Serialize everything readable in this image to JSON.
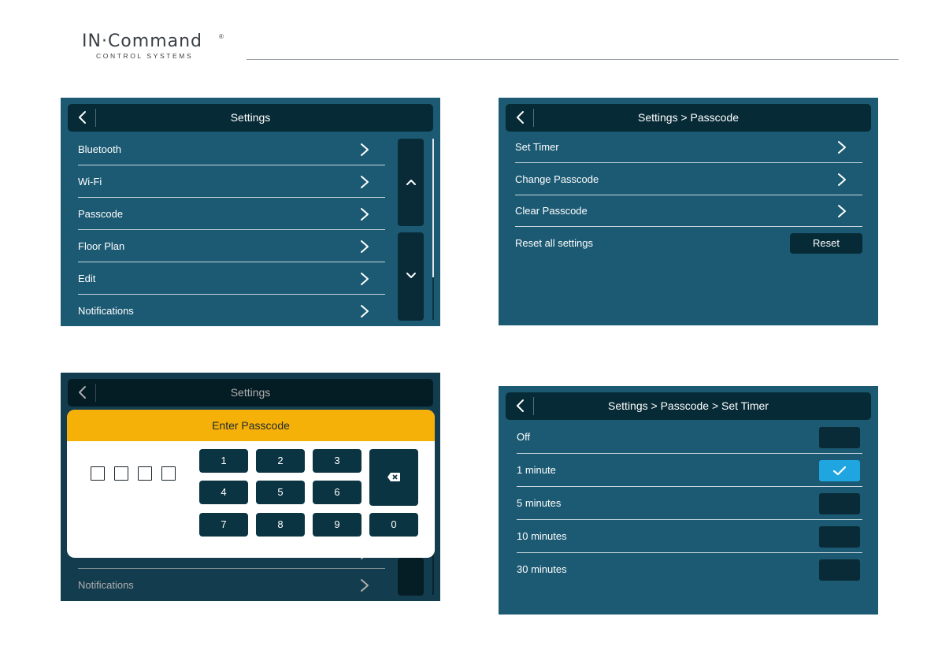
{
  "brand": {
    "name": "IN·Command",
    "registered": "®",
    "tagline": "CONTROL SYSTEMS"
  },
  "colors": {
    "screen_bg": "#1c5a73",
    "bar_bg": "#062a36",
    "modal_header": "#f6b108",
    "selected": "#1fa5e0"
  },
  "icons": [
    "back-chevron-icon",
    "chevron-right-icon",
    "chevron-up-icon",
    "chevron-down-icon",
    "checkmark-icon",
    "backspace-icon"
  ],
  "screen1": {
    "title": "Settings",
    "items": [
      {
        "label": "Bluetooth"
      },
      {
        "label": "Wi-Fi"
      },
      {
        "label": "Passcode"
      },
      {
        "label": "Floor Plan"
      },
      {
        "label": "Edit"
      },
      {
        "label": "Notifications"
      }
    ]
  },
  "screen2": {
    "title": "Settings > Passcode",
    "items": [
      {
        "label": "Set Timer"
      },
      {
        "label": "Change Passcode"
      },
      {
        "label": "Clear Passcode"
      }
    ],
    "reset_label": "Reset all settings",
    "reset_button": "Reset"
  },
  "screen3": {
    "title": "Settings",
    "bottom_item": "Notifications",
    "modal_title": "Enter Passcode",
    "keys": [
      "1",
      "2",
      "3",
      "4",
      "5",
      "6",
      "7",
      "8",
      "9",
      "0"
    ]
  },
  "screen4": {
    "title": "Settings > Passcode > Set Timer",
    "options": [
      {
        "label": "Off",
        "selected": false
      },
      {
        "label": "1 minute",
        "selected": true
      },
      {
        "label": "5 minutes",
        "selected": false
      },
      {
        "label": "10 minutes",
        "selected": false
      },
      {
        "label": "30 minutes",
        "selected": false
      }
    ]
  }
}
